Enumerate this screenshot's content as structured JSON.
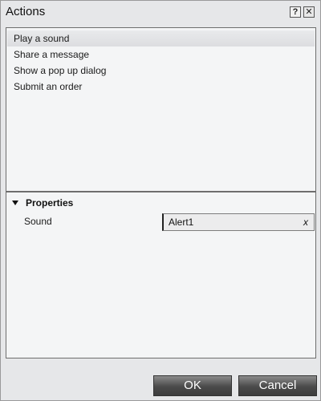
{
  "window": {
    "title": "Actions",
    "help_label": "?",
    "close_label": "✕"
  },
  "actions": {
    "items": [
      {
        "label": "Play a sound",
        "selected": true
      },
      {
        "label": "Share a message",
        "selected": false
      },
      {
        "label": "Show a pop up dialog",
        "selected": false
      },
      {
        "label": "Submit an order",
        "selected": false
      }
    ]
  },
  "properties": {
    "title": "Properties",
    "rows": [
      {
        "label": "Sound",
        "value": "Alert1",
        "clear_label": "x"
      }
    ]
  },
  "footer": {
    "ok_label": "OK",
    "cancel_label": "Cancel"
  }
}
